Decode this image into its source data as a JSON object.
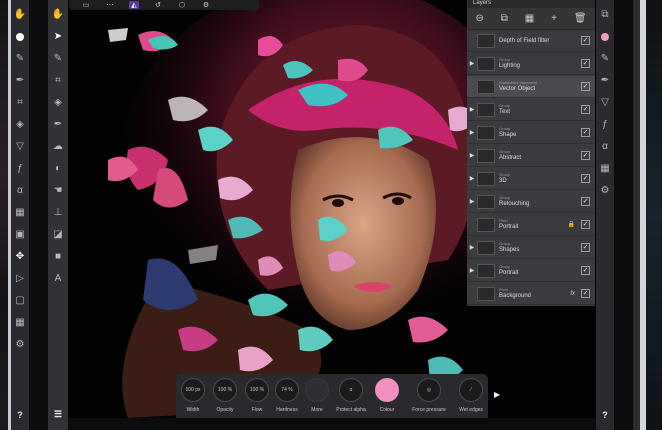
{
  "toolbars": {
    "left": [
      "hand-icon",
      "colour-dot-icon",
      "brush-icon",
      "pen-icon",
      "crop-icon",
      "fill-icon",
      "triangle-icon",
      "fx-icon",
      "smudge-icon",
      "grid-icon",
      "pixel-icon",
      "move-icon",
      "play-icon",
      "square-icon",
      "grid-icon",
      "gear-icon"
    ],
    "mid": [
      "hand-icon",
      "pointer-icon",
      "brush-icon",
      "crop-icon",
      "fill-icon",
      "pen-icon",
      "smudge-icon",
      "dodge-icon",
      "hand-icon",
      "stamp-icon",
      "gradient-icon",
      "square-icon",
      "text-icon"
    ],
    "right": [
      "layers-icon",
      "colour-dot-icon",
      "brush-icon",
      "pen-icon",
      "triangle-icon",
      "fx-icon",
      "smudge-icon",
      "grid-icon",
      "gear-icon"
    ],
    "help_label": "?"
  },
  "context_toolbar": [
    "document-icon",
    "more-icon",
    "affinity-icon",
    "history-icon",
    "snapshot-icon",
    "settings-icon"
  ],
  "layers_panel": {
    "title": "Layers",
    "actions": [
      "mask-icon",
      "stack-icon",
      "adjust-icon",
      "add-icon",
      "delete-icon"
    ],
    "rows": [
      {
        "kind": "",
        "name": "Depth of Field filter",
        "expand": false,
        "checked": true,
        "fx": false,
        "lock": false,
        "selected": false
      },
      {
        "kind": "Group",
        "name": "Lighting",
        "expand": true,
        "checked": true,
        "fx": false,
        "lock": false,
        "selected": false
      },
      {
        "kind": "Embedded document",
        "name": "Vector Object",
        "expand": false,
        "checked": true,
        "fx": false,
        "lock": false,
        "selected": true
      },
      {
        "kind": "Group",
        "name": "Text",
        "expand": true,
        "checked": true,
        "fx": false,
        "lock": false,
        "selected": false
      },
      {
        "kind": "Group",
        "name": "Shape",
        "expand": true,
        "checked": true,
        "fx": false,
        "lock": false,
        "selected": false
      },
      {
        "kind": "Group",
        "name": "Abstract",
        "expand": true,
        "checked": true,
        "fx": false,
        "lock": false,
        "selected": false
      },
      {
        "kind": "Group",
        "name": "3D",
        "expand": true,
        "checked": true,
        "fx": false,
        "lock": false,
        "selected": false
      },
      {
        "kind": "Group",
        "name": "Retouching",
        "expand": true,
        "checked": true,
        "fx": false,
        "lock": false,
        "selected": false
      },
      {
        "kind": "Pixel",
        "name": "Portrait",
        "expand": false,
        "checked": true,
        "fx": false,
        "lock": true,
        "selected": false
      },
      {
        "kind": "Group",
        "name": "Shapes",
        "expand": true,
        "checked": true,
        "fx": false,
        "lock": false,
        "selected": false
      },
      {
        "kind": "Group",
        "name": "Portrait",
        "expand": true,
        "checked": true,
        "fx": false,
        "lock": false,
        "selected": false
      },
      {
        "kind": "Pixel",
        "name": "Background",
        "expand": false,
        "checked": true,
        "fx": true,
        "lock": false,
        "selected": false
      }
    ]
  },
  "brush_controls": [
    {
      "label": "Width",
      "value": "100 px"
    },
    {
      "label": "Opacity",
      "value": "100 %"
    },
    {
      "label": "Flow",
      "value": "100 %"
    },
    {
      "label": "Hardness",
      "value": "74 %"
    },
    {
      "label": "More",
      "value": ""
    },
    {
      "label": "Protect alpha",
      "value": "α"
    },
    {
      "label": "Colour",
      "value": ""
    },
    {
      "label": "Force pressure",
      "value": "◎"
    },
    {
      "label": "Wet edges",
      "value": "⁄"
    }
  ],
  "colors": {
    "accent_colour": "#f08fc0",
    "panel": "#3b3b3f",
    "canvas_background": "#020203"
  }
}
